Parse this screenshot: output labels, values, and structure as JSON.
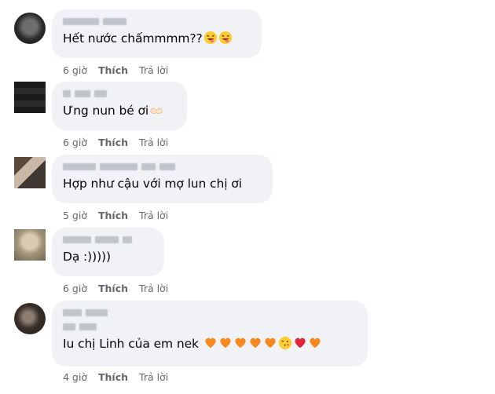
{
  "actions": {
    "like": "Thích",
    "reply": "Trả lời"
  },
  "comments": [
    {
      "text": "Hết nước chấmmmm??",
      "time": "6 giờ"
    },
    {
      "text": "Ưng nun bé ơi",
      "time": "6 giờ"
    },
    {
      "text": "Hợp như cậu với mợ lun chị ơi",
      "time": "5 giờ"
    },
    {
      "text": "Dạ :)))))",
      "time": "6 giờ"
    },
    {
      "text": "Iu chị Linh của em nek",
      "time": "4 giờ"
    }
  ],
  "colors": {
    "bubble": "#f0f2f5",
    "meta": "#65676b",
    "heart_orange": "#f5891f",
    "heart_red": "#e0243b"
  },
  "icons": {
    "c1": [
      "tongue-wink-emoji",
      "tongue-wink-emoji"
    ],
    "c2": [
      "heart-hands-emoji"
    ],
    "c5": [
      "orange-heart-emoji",
      "orange-heart-emoji",
      "orange-heart-emoji",
      "orange-heart-emoji",
      "orange-heart-emoji",
      "kissing-emoji",
      "red-heart-emoji",
      "orange-heart-emoji"
    ]
  }
}
